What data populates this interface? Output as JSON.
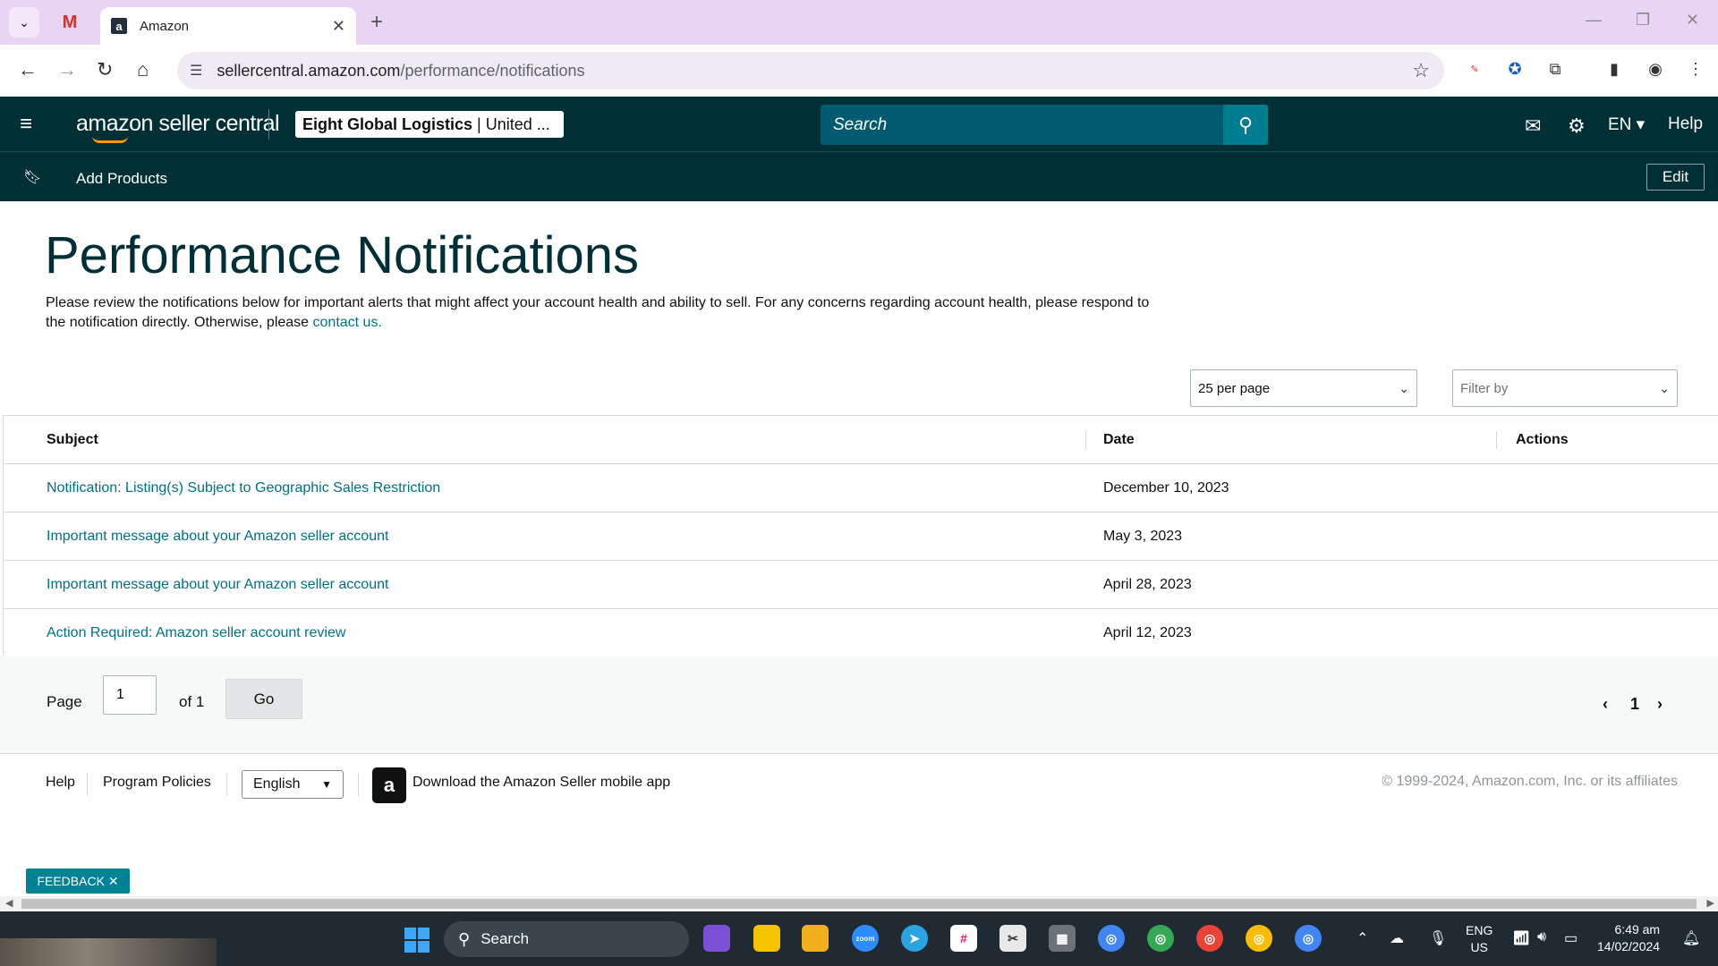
{
  "browser": {
    "tab_title": "Amazon",
    "url_domain": "sellercentral.amazon.com",
    "url_path": "/performance/notifications"
  },
  "header": {
    "logo_text": "amazon seller central",
    "account_name": "Eight Global Logistics",
    "account_region": "United ...",
    "search_placeholder": "Search",
    "language": "EN",
    "help_label": "Help"
  },
  "bookmarks": {
    "items": [
      "Add Products"
    ],
    "edit_label": "Edit"
  },
  "page": {
    "title": "Performance Notifications",
    "description": "Please review the notifications below for important alerts that might affect your account health and ability to sell. For any concerns regarding account health, please respond to the notification directly. Otherwise, please ",
    "contact_link": "contact us."
  },
  "controls": {
    "per_page": "25 per page",
    "filter_placeholder": "Filter by"
  },
  "table": {
    "columns": [
      "Subject",
      "Date",
      "Actions"
    ],
    "rows": [
      {
        "subject": "Notification: Listing(s) Subject to Geographic Sales Restriction",
        "date": "December 10, 2023"
      },
      {
        "subject": "Important message about your Amazon seller account",
        "date": "May 3, 2023"
      },
      {
        "subject": "Important message about your Amazon seller account",
        "date": "April 28, 2023"
      },
      {
        "subject": "Action Required: Amazon seller account review",
        "date": "April 12, 2023"
      }
    ]
  },
  "pagination": {
    "page_label": "Page",
    "page_value": "1",
    "of_label": "of 1",
    "go_label": "Go",
    "current_page": "1"
  },
  "footer": {
    "help": "Help",
    "program_policies": "Program Policies",
    "language": "English",
    "app_download": "Download the Amazon Seller mobile app",
    "copyright": "© 1999-2024, Amazon.com, Inc. or its affiliates"
  },
  "feedback_label": "FEEDBACK",
  "taskbar": {
    "search_label": "Search",
    "lang_line1": "ENG",
    "lang_line2": "US",
    "time": "6:49 am",
    "date": "14/02/2024"
  },
  "colors": {
    "header_bg": "#002f36",
    "link": "#007185",
    "search_bg": "#005b70",
    "tabstrip": "#e8d5f5"
  }
}
